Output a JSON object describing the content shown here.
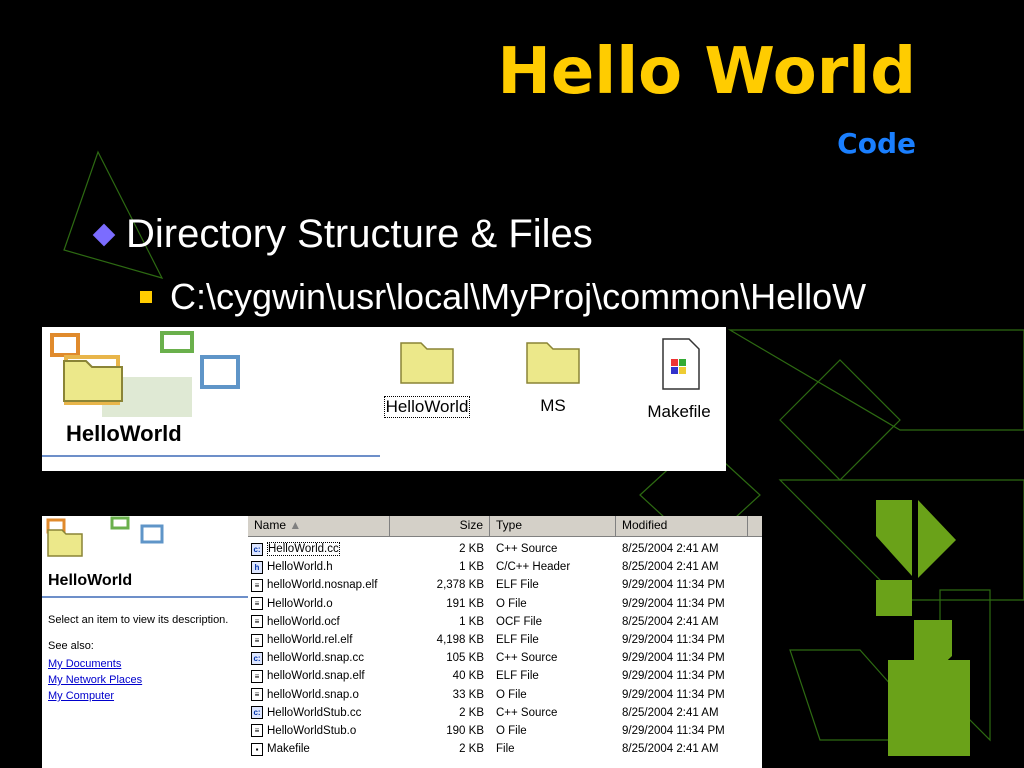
{
  "slide": {
    "title": "Hello World",
    "subtitle": "Code",
    "bullet1": "Directory Structure & Files",
    "bullet2": "C:\\cygwin\\usr\\local\\MyProj\\common\\HelloW",
    "colors": {
      "title": "#ffcc00",
      "subtitle": "#1a7fff",
      "background": "#000000",
      "deco": "#2d6a12",
      "deco_fill": "#6aa219"
    }
  },
  "top_window": {
    "folder_title": "HelloWorld",
    "items": [
      {
        "label": "HelloWorld",
        "icon": "folder-icon",
        "selected": true
      },
      {
        "label": "MS",
        "icon": "folder-icon",
        "selected": false
      },
      {
        "label": "Makefile",
        "icon": "windows-file-icon",
        "selected": false
      }
    ]
  },
  "bottom_window": {
    "folder_title": "HelloWorld",
    "description": "Select an item to view its description.",
    "see_also": "See also:",
    "links": [
      "My Documents",
      "My Network Places",
      "My Computer"
    ],
    "columns": {
      "name": "Name",
      "sort_indicator": "▲",
      "size": "Size",
      "type": "Type",
      "modified": "Modified"
    },
    "files": [
      {
        "name": "HelloWorld.cc",
        "size": "2 KB",
        "type": "C++ Source",
        "modified": "8/25/2004 2:41 AM",
        "icon": "cc"
      },
      {
        "name": "HelloWorld.h",
        "size": "1 KB",
        "type": "C/C++ Header",
        "modified": "8/25/2004 2:41 AM",
        "icon": "h"
      },
      {
        "name": "helloWorld.nosnap.elf",
        "size": "2,378 KB",
        "type": "ELF File",
        "modified": "9/29/2004 11:34 PM",
        "icon": "doc"
      },
      {
        "name": "HelloWorld.o",
        "size": "191 KB",
        "type": "O File",
        "modified": "9/29/2004 11:34 PM",
        "icon": "doc"
      },
      {
        "name": "helloWorld.ocf",
        "size": "1 KB",
        "type": "OCF File",
        "modified": "8/25/2004 2:41 AM",
        "icon": "doc"
      },
      {
        "name": "helloWorld.rel.elf",
        "size": "4,198 KB",
        "type": "ELF File",
        "modified": "9/29/2004 11:34 PM",
        "icon": "doc"
      },
      {
        "name": "helloWorld.snap.cc",
        "size": "105 KB",
        "type": "C++ Source",
        "modified": "9/29/2004 11:34 PM",
        "icon": "cc"
      },
      {
        "name": "helloWorld.snap.elf",
        "size": "40 KB",
        "type": "ELF File",
        "modified": "9/29/2004 11:34 PM",
        "icon": "doc"
      },
      {
        "name": "helloWorld.snap.o",
        "size": "33 KB",
        "type": "O File",
        "modified": "9/29/2004 11:34 PM",
        "icon": "doc"
      },
      {
        "name": "HelloWorldStub.cc",
        "size": "2 KB",
        "type": "C++ Source",
        "modified": "8/25/2004 2:41 AM",
        "icon": "cc"
      },
      {
        "name": "HelloWorldStub.o",
        "size": "190 KB",
        "type": "O File",
        "modified": "9/29/2004 11:34 PM",
        "icon": "doc"
      },
      {
        "name": "Makefile",
        "size": "2 KB",
        "type": "File",
        "modified": "8/25/2004 2:41 AM",
        "icon": "make"
      }
    ]
  }
}
